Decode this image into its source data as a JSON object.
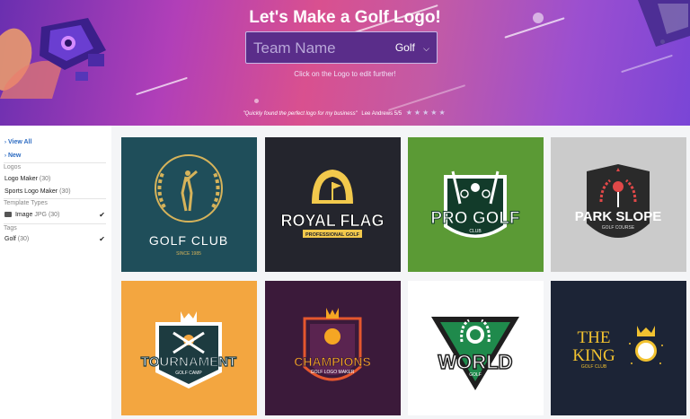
{
  "hero": {
    "title": "Let's Make a Golf Logo!",
    "search_placeholder": "Team Name",
    "category_select": "Golf",
    "hint": "Click on the Logo to edit further!",
    "review_quote": "\"Quickly found the perfect logo for my business\"",
    "review_author": "Lee Andrews 5/5",
    "review_stars": "★★★★★"
  },
  "sidebar": {
    "view_all": "View All",
    "new": "New",
    "logos_heading": "Logos",
    "logo_maker_label": "Logo Maker",
    "logo_maker_count": "(30)",
    "sports_logo_maker_label": "Sports Logo Maker",
    "sports_logo_maker_count": "(30)",
    "template_types_heading": "Template Types",
    "image_label": "Image",
    "image_format": "JPG",
    "image_count": "(30)",
    "tags_heading": "Tags",
    "golf_label": "Golf",
    "golf_count": "(30)",
    "check": "✔"
  },
  "logos": [
    {
      "name": "GOLF CLUB",
      "sub": "SINCE 1985",
      "bg": "#1f4e5a",
      "fg": "#d6b35a"
    },
    {
      "name": "ROYAL FLAG",
      "sub": "PROFESSIONAL GOLF",
      "bg": "#24252d",
      "fg": "#f2c94c"
    },
    {
      "name": "PRO GOLF",
      "sub": "CLUB",
      "bg": "#5b9a35",
      "fg": "#ffffff"
    },
    {
      "name": "PARK SLOPE",
      "sub": "GOLF COURSE",
      "bg": "#cbcbcb",
      "fg": "#2a2a2a"
    },
    {
      "name": "TOURNAMENT",
      "sub": "GOLF CAMP",
      "bg": "#f3a640",
      "fg": "#ffffff"
    },
    {
      "name": "CHAMPIONS",
      "sub": "GOLF LOGO MAKER",
      "bg": "#3b1a3a",
      "fg": "#f5a623"
    },
    {
      "name": "WORLD",
      "sub": "GOLF",
      "bg": "#ffffff",
      "fg": "#1f1f1f"
    },
    {
      "name": "THE",
      "name2": "KING",
      "sub": "GOLF CLUB",
      "bg": "#1c2436",
      "fg": "#f2c230"
    }
  ]
}
